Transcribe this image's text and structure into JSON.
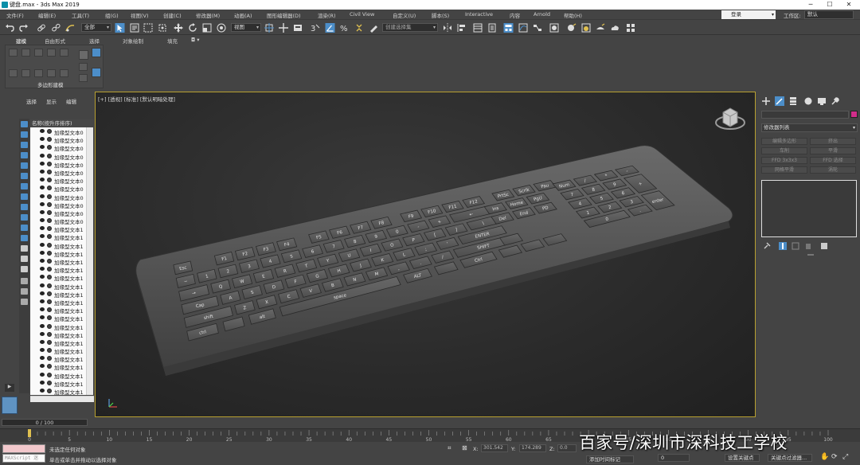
{
  "window": {
    "title": "键盘.max - 3ds Max 2019",
    "controls": [
      "─",
      "☐",
      "✕"
    ]
  },
  "menu": {
    "items": [
      "文件(F)",
      "编辑(E)",
      "工具(T)",
      "组(G)",
      "视图(V)",
      "创建(C)",
      "修改器(M)",
      "动画(A)",
      "图形编辑器(D)",
      "渲染(R)",
      "Civil View",
      "自定义(U)",
      "脚本(S)",
      "Interactive",
      "内容",
      "Arnold",
      "帮助(H)"
    ],
    "signin": "登录",
    "workspace_label": "工作区:",
    "workspace_value": "默认"
  },
  "toolbar": {
    "filter_value": "全部",
    "view_value": "视图",
    "selection_set_placeholder": "创建选择集"
  },
  "ribbon": {
    "tabs": [
      "建模",
      "自由形式",
      "选择",
      "对象绘制",
      "填充"
    ],
    "caption": "多边形建模"
  },
  "explorer": {
    "tabs": [
      "选择",
      "显示",
      "编辑"
    ],
    "header": "名称(按升序排序)",
    "rows": [
      "加缘型文本0",
      "加缘型文本0",
      "加缘型文本0",
      "加缘型文本0",
      "加缘型文本0",
      "加缘型文本0",
      "加缘型文本0",
      "加缘型文本0",
      "加缘型文本0",
      "加缘型文本0",
      "加缘型文本0",
      "加缘型文本0",
      "加缘型文本1",
      "加缘型文本1",
      "加缘型文本1",
      "加缘型文本1",
      "加缘型文本1",
      "加缘型文本1",
      "加缘型文本1",
      "加缘型文本1",
      "加缘型文本1",
      "加缘型文本1",
      "加缘型文本1",
      "加缘型文本1",
      "加缘型文本1",
      "加缘型文本1",
      "加缘型文本1",
      "加缘型文本1",
      "加缘型文本1",
      "加缘型文本1",
      "加缘型文本1",
      "加缘型文本1",
      "加缘型文本1"
    ]
  },
  "viewport": {
    "label": "[+] [透视] [标准] [默认明暗处理]"
  },
  "keyboard": {
    "fn_row": [
      "Esc",
      "F1",
      "F2",
      "F3",
      "F4",
      "F5",
      "F6",
      "F7",
      "F8",
      "F9",
      "F10",
      "F11",
      "F12",
      "PrtSc",
      "Scrlk",
      "Pau"
    ],
    "num_row": [
      "~",
      "1",
      "2",
      "3",
      "4",
      "5",
      "6",
      "7",
      "8",
      "9",
      "0",
      "-",
      "+",
      "←"
    ],
    "q_row": [
      "→",
      "Q",
      "W",
      "E",
      "R",
      "T",
      "Y",
      "U",
      "I",
      "O",
      "P",
      "[",
      "]",
      "\\"
    ],
    "a_row": [
      "Cap",
      "A",
      "S",
      "D",
      "F",
      "G",
      "H",
      "J",
      "K",
      "L",
      ";",
      "'",
      "ENTER"
    ],
    "z_row": [
      "shift",
      "Z",
      "X",
      "C",
      "V",
      "B",
      "N",
      "M",
      ",",
      ".",
      "/",
      "SHIFT"
    ],
    "bottom_row": [
      "ctrl",
      "",
      "alt",
      "space",
      "ALT",
      "",
      "Ctrl"
    ],
    "nav": [
      "Ins",
      "Home",
      "PgU",
      "Del",
      "End",
      "PD"
    ],
    "numpad": [
      "Num",
      "/",
      "*",
      "-",
      "7",
      "8",
      "9",
      "+",
      "4",
      "5",
      "6",
      "1",
      "2",
      "3",
      "enter",
      "0",
      "."
    ]
  },
  "command_panel": {
    "modifier_list": "修改器列表",
    "buttons": [
      "编辑多边形",
      "挤出",
      "车削",
      "平滑",
      "FFD 3x3x3",
      "FFD 选择",
      "网格平滑",
      "涡轮"
    ]
  },
  "timeline": {
    "frame_display": "0 / 100",
    "ticks": [
      "0",
      "5",
      "10",
      "15",
      "20",
      "25",
      "30",
      "35",
      "40",
      "45",
      "50",
      "55",
      "60",
      "65",
      "70",
      "75",
      "80",
      "85",
      "90",
      "95",
      "100"
    ]
  },
  "status": {
    "maxscript": "MAXScript 迷",
    "line1": "未选定任何对象",
    "line2": "单击或单击并拖动以选择对象",
    "x_label": "X:",
    "x_value": "301.542",
    "y_label": "Y:",
    "y_value": "174.289",
    "z_label": "Z:",
    "z_value": "0.0",
    "add_time_tag": "添加时间标记",
    "set_key": "设置关键点",
    "key_filters": "关键点过滤器...",
    "spinner_value": "0"
  },
  "watermark": "百家号/深圳市深科技工学校",
  "colors": {
    "accent_blue": "#4c8ec9",
    "viewport_border": "#b8a030",
    "object_color": "#d12d8a"
  }
}
